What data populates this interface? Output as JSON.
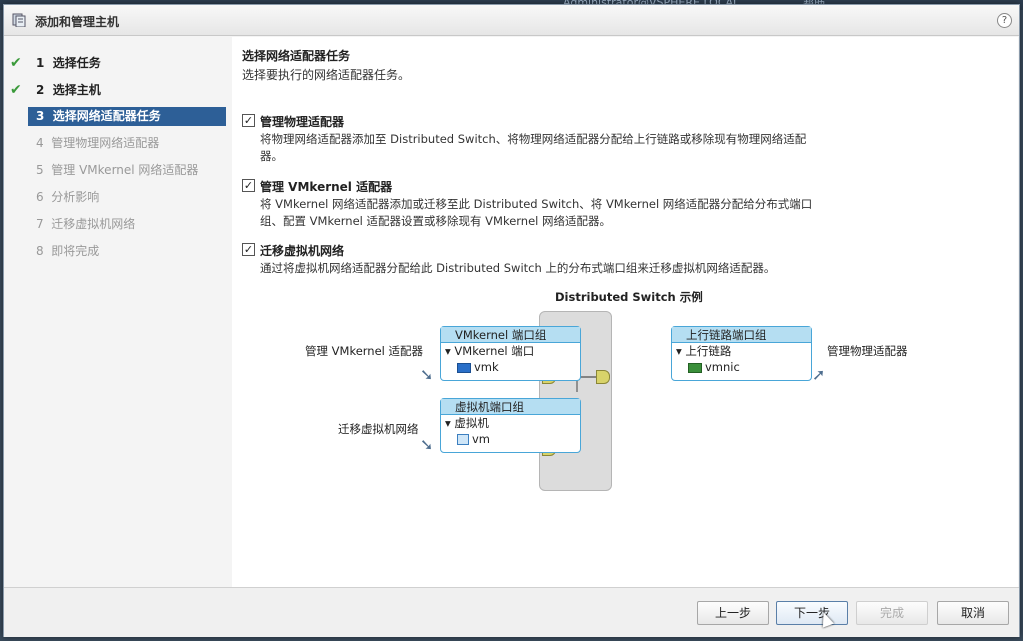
{
  "background": {
    "user": "Administrator@VSPHERE.LOCAL",
    "help": "帮助"
  },
  "dialog": {
    "title": "添加和管理主机",
    "help_glyph": "?"
  },
  "nav": {
    "items": [
      {
        "num": "1",
        "label": "选择任务",
        "state": "done"
      },
      {
        "num": "2",
        "label": "选择主机",
        "state": "done"
      },
      {
        "num": "3",
        "label": "选择网络适配器任务",
        "state": "active"
      },
      {
        "num": "4",
        "label": "管理物理网络适配器",
        "state": "pending"
      },
      {
        "num": "5",
        "label": "管理 VMkernel 网络适配器",
        "state": "pending"
      },
      {
        "num": "6",
        "label": "分析影响",
        "state": "pending"
      },
      {
        "num": "7",
        "label": "迁移虚拟机网络",
        "state": "pending"
      },
      {
        "num": "8",
        "label": "即将完成",
        "state": "pending"
      }
    ]
  },
  "main": {
    "title": "选择网络适配器任务",
    "subtitle": "选择要执行的网络适配器任务。",
    "tasks": [
      {
        "checked": true,
        "label": "管理物理适配器",
        "desc": "将物理网络适配器添加至 Distributed Switch、将物理网络适配器分配给上行链路或移除现有物理网络适配器。"
      },
      {
        "checked": true,
        "label": "管理 VMkernel 适配器",
        "desc": "将 VMkernel 网络适配器添加或迁移至此 Distributed Switch、将 VMkernel 网络适配器分配给分布式端口组、配置 VMkernel 适配器设置或移除现有 VMkernel 网络适配器。"
      },
      {
        "checked": true,
        "label": "迁移虚拟机网络",
        "desc": "通过将虚拟机网络适配器分配给此 Distributed Switch 上的分布式端口组来迁移虚拟机网络适配器。"
      }
    ]
  },
  "diagram": {
    "title": "Distributed Switch 示例",
    "left_label_1": "管理 VMkernel 适配器",
    "left_label_2": "迁移虚拟机网络",
    "right_label": "管理物理适配器",
    "box_vmk": {
      "head": "VMkernel 端口组",
      "line1": "▾ VMkernel 端口",
      "line2": "vmk"
    },
    "box_vm": {
      "head": "虚拟机端口组",
      "line1": "▾ 虚拟机",
      "line2": "vm"
    },
    "box_uplink": {
      "head": "上行链路端口组",
      "line1": "▾ 上行链路",
      "line2": "vmnic"
    }
  },
  "footer": {
    "back": "上一步",
    "next": "下一步",
    "finish": "完成",
    "cancel": "取消"
  }
}
